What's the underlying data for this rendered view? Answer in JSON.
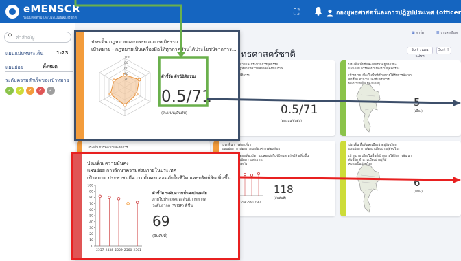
{
  "header": {
    "app_title": "eMENSCR",
    "app_subtitle": "ระบบติดตามและประเมินผลแห่งชาติ",
    "user_name": "กองยุทธศาสตร์และการปฏิรูปประเทศ (officer)",
    "bg_color": "#1565c0"
  },
  "filters": {
    "search_placeholder": "คำสำคัญ",
    "plan_label": "แผนแม่บทประเด็น",
    "plan_value": "1-23",
    "subplan_label": "แผนย่อย",
    "subplan_value": "ทั้งหมด",
    "level_label": "ระดับความสำเร็จของเป้าหมาย",
    "level_colors": [
      "#8bc34a",
      "#cddc39",
      "#f39c3c",
      "#e05555",
      "#9e9e9e"
    ]
  },
  "toolbar": {
    "view_card": "การ์ด",
    "view_list": "รายละเอียด",
    "sort_label": "Sort : แผนแม่บท",
    "sort_dir": "Sort ↑"
  },
  "section_title": "ภายใต้ยุทธศาสตร์ชาติ",
  "bg_cards": [
    {
      "strip": "#f39c3c",
      "lines": [
        "ประเด็น กฎหมายและกระบวนการยุติธรรม",
        "เป้าหมาย - กฎหมายมีความสอดคล้องกับบริบท",
        "ตัวชี้วัด ดัชนีนิติธรรม"
      ],
      "value": "0.5/71",
      "unit": "(คะแนน/อันดับ)"
    },
    {
      "strip": "#8bc34a",
      "lines": [
        "ประเด็น พื้นที่และเมืองน่าอยู่อัจฉริยะ",
        "แผนย่อย การพัฒนาเมืองน่าอยู่อัจฉริยะ",
        "เป้าหมาย เมืองในพื้นที่เป้าหมายได้รับการพัฒนา",
        "ตัวชี้วัด จำนวนเมืองที่ได้รับการ",
        "พัฒนาให้เป็นเมืองน่าอยู่"
      ],
      "value": "5",
      "unit": "(เมือง)"
    },
    {
      "strip": "#f39c3c",
      "lines": [
        "ประเด็น การท่องเที่ยว",
        "แผนย่อย การพัฒนาระบบนิเวศการท่องเที่ยว",
        "เป้าหมาย นักท่องเที่ยวมีความปลอดภัยในชีวิตและทรัพย์สินเพิ่มขึ้น",
        "ตัวชี้วัด อันดับขีดความสามารถ",
        "ด้านความปลอดภัย"
      ],
      "value": "118",
      "unit": "(อันดับที่)",
      "years": "2557 2558 2559 2560 2561"
    },
    {
      "strip": "#cddc39",
      "lines": [
        "ประเด็น พื้นที่และเมืองน่าอยู่อัจฉริยะ",
        "แผนย่อย การพัฒนาเมืองน่าอยู่อัจฉริยะ",
        "เป้าหมาย เมืองในพื้นที่เป้าหมายได้รับการพัฒนา",
        "ตัวชี้วัด จำนวนเมืองน่าอยู่ที่มี",
        "ความเป็นอัจฉริยะ"
      ],
      "value": "6",
      "unit": "(เมือง)"
    },
    {
      "strip": "#f39c3c",
      "lines": [
        "ประเด็น การพัฒนาและจัดการ"
      ],
      "value": "",
      "unit": ""
    }
  ],
  "popup_top": {
    "strip_color": "#f39c3c",
    "issue": "ประเด็น กฎหมายและกระบวนการยุติธรรม",
    "goal": "เป้าหมาย - กฎหมายเป็นเครื่องมือให้ทุกภาคส่วนได้ประโยชน์จากการ...",
    "radar_ticks": [
      "100",
      "80",
      "60",
      "40",
      "20"
    ],
    "indicator_label": "ตัวชี้วัด ดัชนีนิติธรรม",
    "value": "0.5/71",
    "unit": "(คะแนน/อันดับ)"
  },
  "popup_bottom": {
    "strip_color": "#e05555",
    "issue": "ประเด็น ความมั่นคง",
    "subplan": "แผนย่อย การรักษาความสงบภายในประเทศ",
    "goal": "เป้าหมาย ประชาชนมีความมั่นคงปลอดภัยในชีวิต และทรัพย์สินเพิ่มขึ้น",
    "indicator_lines": [
      "ตัวชี้วัด ระดับความมั่นคงปลอดภัย",
      "ภายในประเทศและสันติภาพสากล",
      "ระดับสากล (WISP) ดีขึ้น"
    ],
    "value": "69",
    "unit": "(อันดับที่)",
    "chart_data": {
      "type": "line",
      "x": [
        "2557",
        "2558",
        "2559",
        "2560",
        "2561"
      ],
      "y": [
        82,
        80,
        78,
        70,
        72
      ],
      "ylim": [
        0,
        100
      ],
      "yticks": [
        "100",
        "90",
        "80",
        "70",
        "60",
        "50",
        "40",
        "30",
        "20",
        "10",
        "0"
      ],
      "colors": [
        "#d04848",
        "#d04848",
        "#d04848",
        "#f39c3c",
        "#d04848"
      ]
    }
  },
  "annotations": {
    "green_color": "#6ab04c",
    "red_color": "#e82020",
    "gray_arrow_color": "#3d4f6a"
  }
}
